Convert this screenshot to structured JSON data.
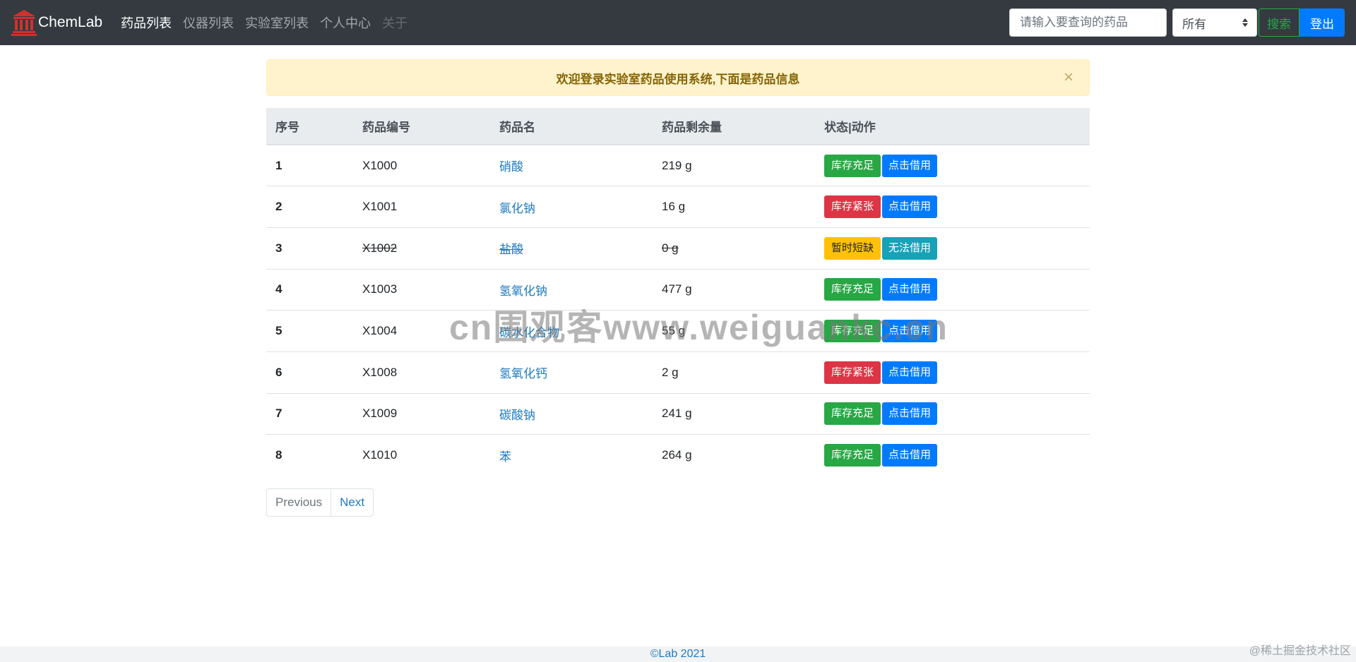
{
  "navbar": {
    "brand": "ChemLab",
    "logo_icon": "museum-building-icon",
    "logo_color": "#d0312d",
    "items": [
      {
        "label": "药品列表",
        "state": "active"
      },
      {
        "label": "仪器列表",
        "state": "normal"
      },
      {
        "label": "实验室列表",
        "state": "normal"
      },
      {
        "label": "个人中心",
        "state": "normal"
      },
      {
        "label": "关于",
        "state": "disabled"
      }
    ],
    "search": {
      "placeholder": "请输入要查询的药品",
      "value": ""
    },
    "filter": {
      "selected": "所有"
    },
    "search_button": "搜索",
    "logout_button": "登出"
  },
  "alert": {
    "message": "欢迎登录实验室药品使用系统,下面是药品信息",
    "close": "×"
  },
  "table": {
    "headers": [
      "序号",
      "药品编号",
      "药品名",
      "药品剩余量",
      "状态|动作"
    ],
    "rows": [
      {
        "idx": "1",
        "code": "X1000",
        "name": "硝酸",
        "amount": "219 g",
        "status": "库存充足",
        "status_type": "success",
        "action": "点击借用",
        "action_type": "primary",
        "struck": false
      },
      {
        "idx": "2",
        "code": "X1001",
        "name": "氯化钠",
        "amount": "16 g",
        "status": "库存紧张",
        "status_type": "danger",
        "action": "点击借用",
        "action_type": "primary",
        "struck": false
      },
      {
        "idx": "3",
        "code": "X1002",
        "name": "盐酸",
        "amount": "0 g",
        "status": "暂时短缺",
        "status_type": "warning",
        "action": "无法借用",
        "action_type": "info",
        "struck": true
      },
      {
        "idx": "4",
        "code": "X1003",
        "name": "氢氧化钠",
        "amount": "477 g",
        "status": "库存充足",
        "status_type": "success",
        "action": "点击借用",
        "action_type": "primary",
        "struck": false
      },
      {
        "idx": "5",
        "code": "X1004",
        "name": "碳水化合物",
        "amount": "55 g",
        "status": "库存充足",
        "status_type": "success",
        "action": "点击借用",
        "action_type": "primary",
        "struck": false
      },
      {
        "idx": "6",
        "code": "X1008",
        "name": "氢氧化钙",
        "amount": "2 g",
        "status": "库存紧张",
        "status_type": "danger",
        "action": "点击借用",
        "action_type": "primary",
        "struck": false
      },
      {
        "idx": "7",
        "code": "X1009",
        "name": "碳酸钠",
        "amount": "241 g",
        "status": "库存充足",
        "status_type": "success",
        "action": "点击借用",
        "action_type": "primary",
        "struck": false
      },
      {
        "idx": "8",
        "code": "X1010",
        "name": "苯",
        "amount": "264 g",
        "status": "库存充足",
        "status_type": "success",
        "action": "点击借用",
        "action_type": "primary",
        "struck": false
      }
    ]
  },
  "pagination": {
    "previous": "Previous",
    "next": "Next"
  },
  "footer": {
    "text": "©Lab 2021"
  },
  "corner_mark": "@稀土掘金技术社区",
  "watermark": "cn围观客www.weiguankc.cn",
  "colors": {
    "navbar_bg": "#343a40",
    "success": "#28a745",
    "danger": "#dc3545",
    "warning": "#ffc107",
    "primary": "#007bff",
    "info": "#17a2b8",
    "alert_bg": "#fff3cd",
    "link": "#1f7bbf"
  }
}
